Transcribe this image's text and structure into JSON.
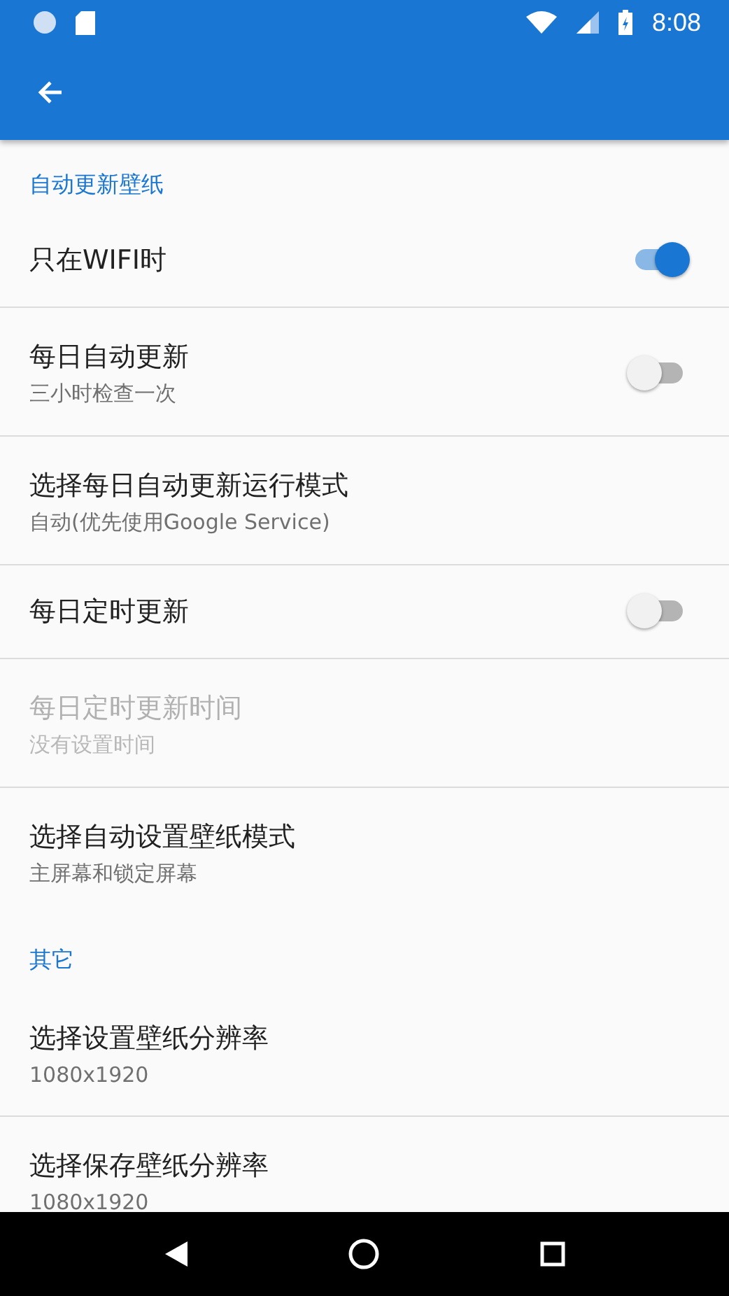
{
  "status_bar": {
    "time": "8:08"
  },
  "sections": [
    {
      "title": "自动更新壁纸",
      "items": [
        {
          "kind": "switch",
          "title": "只在WIFI时",
          "on": true,
          "disabled": false
        },
        {
          "kind": "switch",
          "title": "每日自动更新",
          "subtitle": "三小时检查一次",
          "on": false,
          "disabled": false
        },
        {
          "kind": "text",
          "title": "选择每日自动更新运行模式",
          "subtitle": "自动(优先使用Google Service)",
          "disabled": false
        },
        {
          "kind": "switch",
          "title": "每日定时更新",
          "on": false,
          "disabled": false
        },
        {
          "kind": "text",
          "title": "每日定时更新时间",
          "subtitle": "没有设置时间",
          "disabled": true
        },
        {
          "kind": "text",
          "title": "选择自动设置壁纸模式",
          "subtitle": "主屏幕和锁定屏幕",
          "disabled": false
        }
      ]
    },
    {
      "title": "其它",
      "items": [
        {
          "kind": "text",
          "title": "选择设置壁纸分辨率",
          "subtitle": "1080x1920",
          "disabled": false
        },
        {
          "kind": "text",
          "title": "选择保存壁纸分辨率",
          "subtitle": "1080x1920",
          "disabled": false
        }
      ]
    }
  ]
}
